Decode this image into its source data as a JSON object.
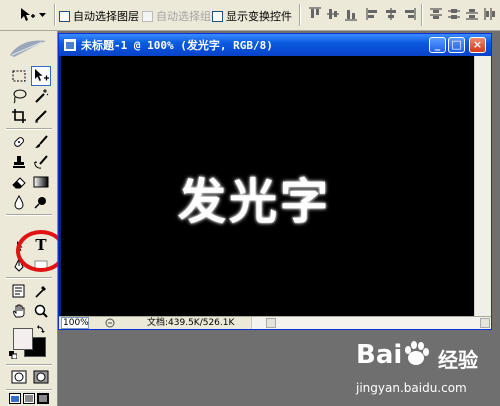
{
  "options_bar": {
    "auto_select_layer": "自动选择图层",
    "auto_select_group": "自动选择组",
    "show_transform_controls": "显示变换控件"
  },
  "document": {
    "title": "未标题-1 @ 100% (发光字, RGB/8)",
    "canvas_text": "发光字",
    "canvas_background": "#000000",
    "canvas_text_color": "#ffffff",
    "window_buttons": {
      "minimize": "_",
      "maximize": "□",
      "close": "×"
    },
    "status": {
      "zoom": "100%",
      "doc_info": "文档:439.5K/526.1K"
    }
  },
  "toolbox": {
    "foreground_color": "#f4eeee",
    "background_color": "#000000",
    "type_tool_glyph": "T",
    "annotation_color": "#e01212"
  },
  "watermark": {
    "logo": "Bai",
    "logo_suffix": "经验",
    "url": "jingyan.baidu.com"
  },
  "icons": [
    "move-tool-icon",
    "marquee-icon",
    "lasso-icon",
    "magic-wand-icon",
    "crop-icon",
    "slice-icon",
    "healing-brush-icon",
    "brush-icon",
    "clone-stamp-icon",
    "history-brush-icon",
    "eraser-icon",
    "gradient-icon",
    "blur-icon",
    "dodge-icon",
    "path-select-icon",
    "type-tool-icon",
    "pen-icon",
    "shape-icon",
    "notes-icon",
    "eyedropper-icon",
    "hand-icon",
    "zoom-icon",
    "swap-colors-icon",
    "default-colors-icon",
    "standard-mode-icon",
    "quick-mask-icon",
    "screen-mode-icons"
  ]
}
